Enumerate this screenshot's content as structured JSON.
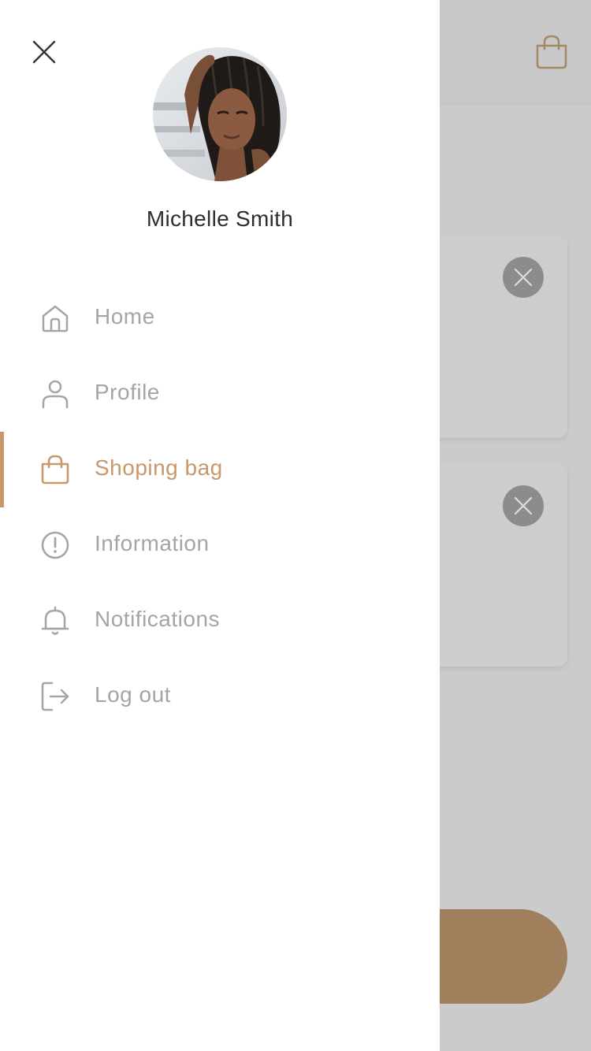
{
  "user": {
    "name": "Michelle Smith"
  },
  "menu": {
    "items": [
      {
        "label": "Home",
        "icon": "home-icon",
        "active": false
      },
      {
        "label": "Profile",
        "icon": "user-icon",
        "active": false
      },
      {
        "label": "Shoping bag",
        "icon": "shopping-bag-icon",
        "active": true
      },
      {
        "label": "Information",
        "icon": "info-icon",
        "active": false
      },
      {
        "label": "Notifications",
        "icon": "bell-icon",
        "active": false
      },
      {
        "label": "Log out",
        "icon": "logout-icon",
        "active": false
      }
    ]
  },
  "colors": {
    "accent": "#c9986a",
    "inactive": "#a5a5a5",
    "name_text": "#2e2e2e",
    "overlay": "#cbcbcb",
    "cta": "#a0805c"
  }
}
